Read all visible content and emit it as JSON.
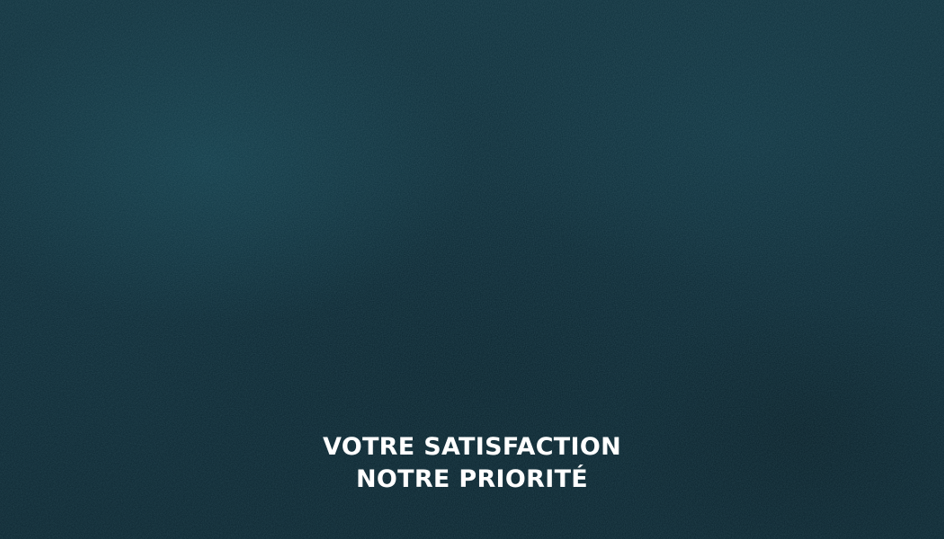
{
  "background": {
    "base_color": "#0c2b36",
    "texture": "felt-noise"
  },
  "tagline": {
    "line1": "VOTRE SATISFACTION",
    "line2": "NOTRE PRIORITÉ",
    "color": "#ffffff"
  }
}
